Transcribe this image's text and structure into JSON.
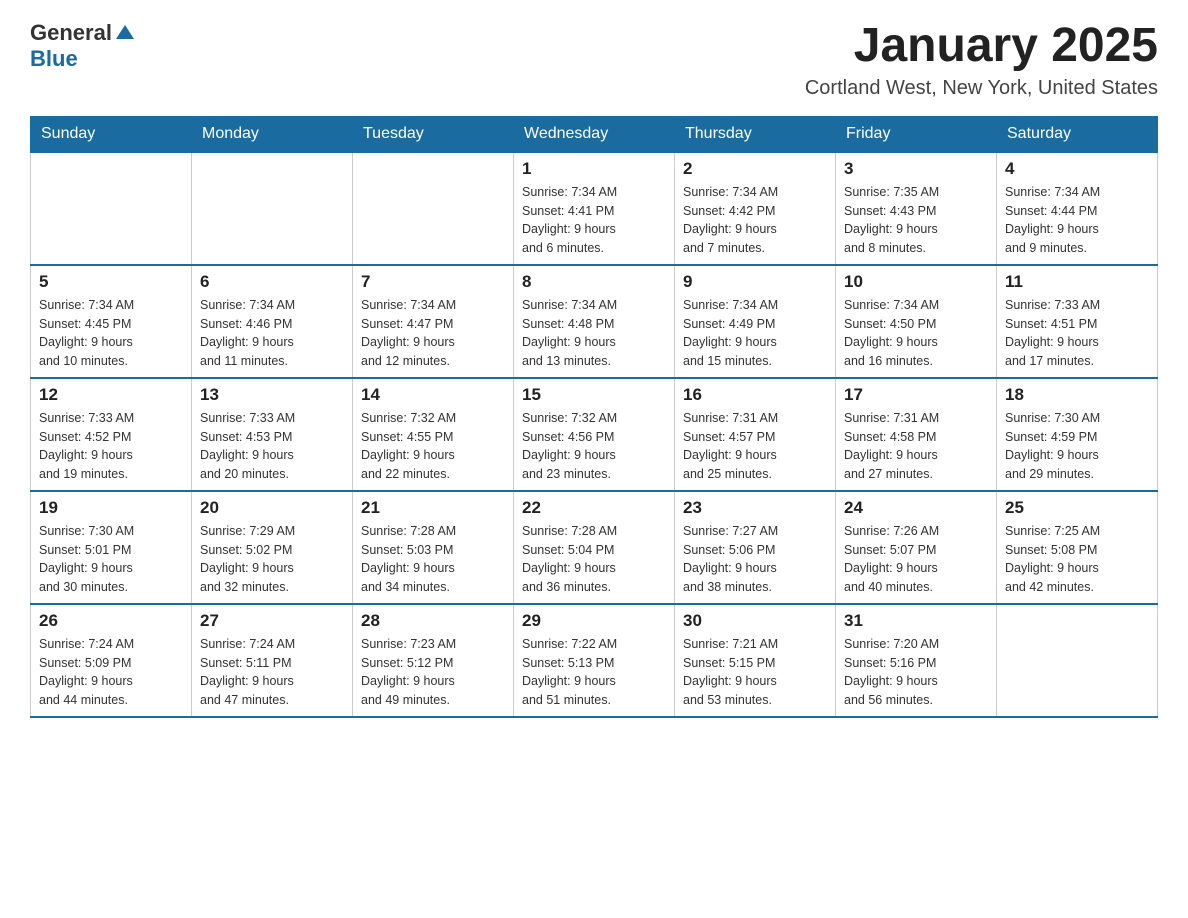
{
  "header": {
    "logo_general": "General",
    "logo_blue": "Blue",
    "month_title": "January 2025",
    "location": "Cortland West, New York, United States"
  },
  "days_of_week": [
    "Sunday",
    "Monday",
    "Tuesday",
    "Wednesday",
    "Thursday",
    "Friday",
    "Saturday"
  ],
  "weeks": [
    [
      {
        "day": "",
        "info": ""
      },
      {
        "day": "",
        "info": ""
      },
      {
        "day": "",
        "info": ""
      },
      {
        "day": "1",
        "info": "Sunrise: 7:34 AM\nSunset: 4:41 PM\nDaylight: 9 hours\nand 6 minutes."
      },
      {
        "day": "2",
        "info": "Sunrise: 7:34 AM\nSunset: 4:42 PM\nDaylight: 9 hours\nand 7 minutes."
      },
      {
        "day": "3",
        "info": "Sunrise: 7:35 AM\nSunset: 4:43 PM\nDaylight: 9 hours\nand 8 minutes."
      },
      {
        "day": "4",
        "info": "Sunrise: 7:34 AM\nSunset: 4:44 PM\nDaylight: 9 hours\nand 9 minutes."
      }
    ],
    [
      {
        "day": "5",
        "info": "Sunrise: 7:34 AM\nSunset: 4:45 PM\nDaylight: 9 hours\nand 10 minutes."
      },
      {
        "day": "6",
        "info": "Sunrise: 7:34 AM\nSunset: 4:46 PM\nDaylight: 9 hours\nand 11 minutes."
      },
      {
        "day": "7",
        "info": "Sunrise: 7:34 AM\nSunset: 4:47 PM\nDaylight: 9 hours\nand 12 minutes."
      },
      {
        "day": "8",
        "info": "Sunrise: 7:34 AM\nSunset: 4:48 PM\nDaylight: 9 hours\nand 13 minutes."
      },
      {
        "day": "9",
        "info": "Sunrise: 7:34 AM\nSunset: 4:49 PM\nDaylight: 9 hours\nand 15 minutes."
      },
      {
        "day": "10",
        "info": "Sunrise: 7:34 AM\nSunset: 4:50 PM\nDaylight: 9 hours\nand 16 minutes."
      },
      {
        "day": "11",
        "info": "Sunrise: 7:33 AM\nSunset: 4:51 PM\nDaylight: 9 hours\nand 17 minutes."
      }
    ],
    [
      {
        "day": "12",
        "info": "Sunrise: 7:33 AM\nSunset: 4:52 PM\nDaylight: 9 hours\nand 19 minutes."
      },
      {
        "day": "13",
        "info": "Sunrise: 7:33 AM\nSunset: 4:53 PM\nDaylight: 9 hours\nand 20 minutes."
      },
      {
        "day": "14",
        "info": "Sunrise: 7:32 AM\nSunset: 4:55 PM\nDaylight: 9 hours\nand 22 minutes."
      },
      {
        "day": "15",
        "info": "Sunrise: 7:32 AM\nSunset: 4:56 PM\nDaylight: 9 hours\nand 23 minutes."
      },
      {
        "day": "16",
        "info": "Sunrise: 7:31 AM\nSunset: 4:57 PM\nDaylight: 9 hours\nand 25 minutes."
      },
      {
        "day": "17",
        "info": "Sunrise: 7:31 AM\nSunset: 4:58 PM\nDaylight: 9 hours\nand 27 minutes."
      },
      {
        "day": "18",
        "info": "Sunrise: 7:30 AM\nSunset: 4:59 PM\nDaylight: 9 hours\nand 29 minutes."
      }
    ],
    [
      {
        "day": "19",
        "info": "Sunrise: 7:30 AM\nSunset: 5:01 PM\nDaylight: 9 hours\nand 30 minutes."
      },
      {
        "day": "20",
        "info": "Sunrise: 7:29 AM\nSunset: 5:02 PM\nDaylight: 9 hours\nand 32 minutes."
      },
      {
        "day": "21",
        "info": "Sunrise: 7:28 AM\nSunset: 5:03 PM\nDaylight: 9 hours\nand 34 minutes."
      },
      {
        "day": "22",
        "info": "Sunrise: 7:28 AM\nSunset: 5:04 PM\nDaylight: 9 hours\nand 36 minutes."
      },
      {
        "day": "23",
        "info": "Sunrise: 7:27 AM\nSunset: 5:06 PM\nDaylight: 9 hours\nand 38 minutes."
      },
      {
        "day": "24",
        "info": "Sunrise: 7:26 AM\nSunset: 5:07 PM\nDaylight: 9 hours\nand 40 minutes."
      },
      {
        "day": "25",
        "info": "Sunrise: 7:25 AM\nSunset: 5:08 PM\nDaylight: 9 hours\nand 42 minutes."
      }
    ],
    [
      {
        "day": "26",
        "info": "Sunrise: 7:24 AM\nSunset: 5:09 PM\nDaylight: 9 hours\nand 44 minutes."
      },
      {
        "day": "27",
        "info": "Sunrise: 7:24 AM\nSunset: 5:11 PM\nDaylight: 9 hours\nand 47 minutes."
      },
      {
        "day": "28",
        "info": "Sunrise: 7:23 AM\nSunset: 5:12 PM\nDaylight: 9 hours\nand 49 minutes."
      },
      {
        "day": "29",
        "info": "Sunrise: 7:22 AM\nSunset: 5:13 PM\nDaylight: 9 hours\nand 51 minutes."
      },
      {
        "day": "30",
        "info": "Sunrise: 7:21 AM\nSunset: 5:15 PM\nDaylight: 9 hours\nand 53 minutes."
      },
      {
        "day": "31",
        "info": "Sunrise: 7:20 AM\nSunset: 5:16 PM\nDaylight: 9 hours\nand 56 minutes."
      },
      {
        "day": "",
        "info": ""
      }
    ]
  ]
}
